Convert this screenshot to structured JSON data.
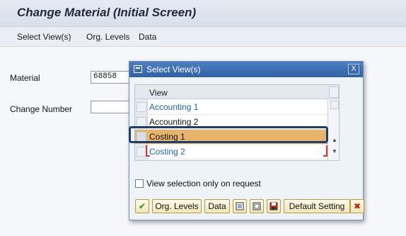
{
  "title": "Change Material (Initial Screen)",
  "menu": [
    "Select View(s)",
    "Org. Levels",
    "Data"
  ],
  "fields": {
    "material_label": "Material",
    "material_value": "68858",
    "change_number_label": "Change Number",
    "change_number_value": ""
  },
  "dialog": {
    "title": "Select View(s)",
    "close_glyph": "X",
    "table_header": "View",
    "rows": [
      {
        "label": "Accounting 1",
        "style": "link",
        "selected": false
      },
      {
        "label": "Accounting 2",
        "style": "plain",
        "selected": false
      },
      {
        "label": "Costing 1",
        "style": "plain",
        "selected": true
      },
      {
        "label": "Costing 2",
        "style": "link",
        "selected": false
      }
    ],
    "checkbox_label": "View selection only on request",
    "buttons": {
      "confirm_glyph": "✔",
      "org_levels": "Org. Levels",
      "data": "Data",
      "default_setting": "Default Setting",
      "cancel_glyph": "✖"
    }
  },
  "colors": {
    "header_blue": "#2f62a6",
    "selected_row": "#e8b46a",
    "link_text": "#1f5fb0",
    "highlight_border": "#1c3f6b"
  }
}
